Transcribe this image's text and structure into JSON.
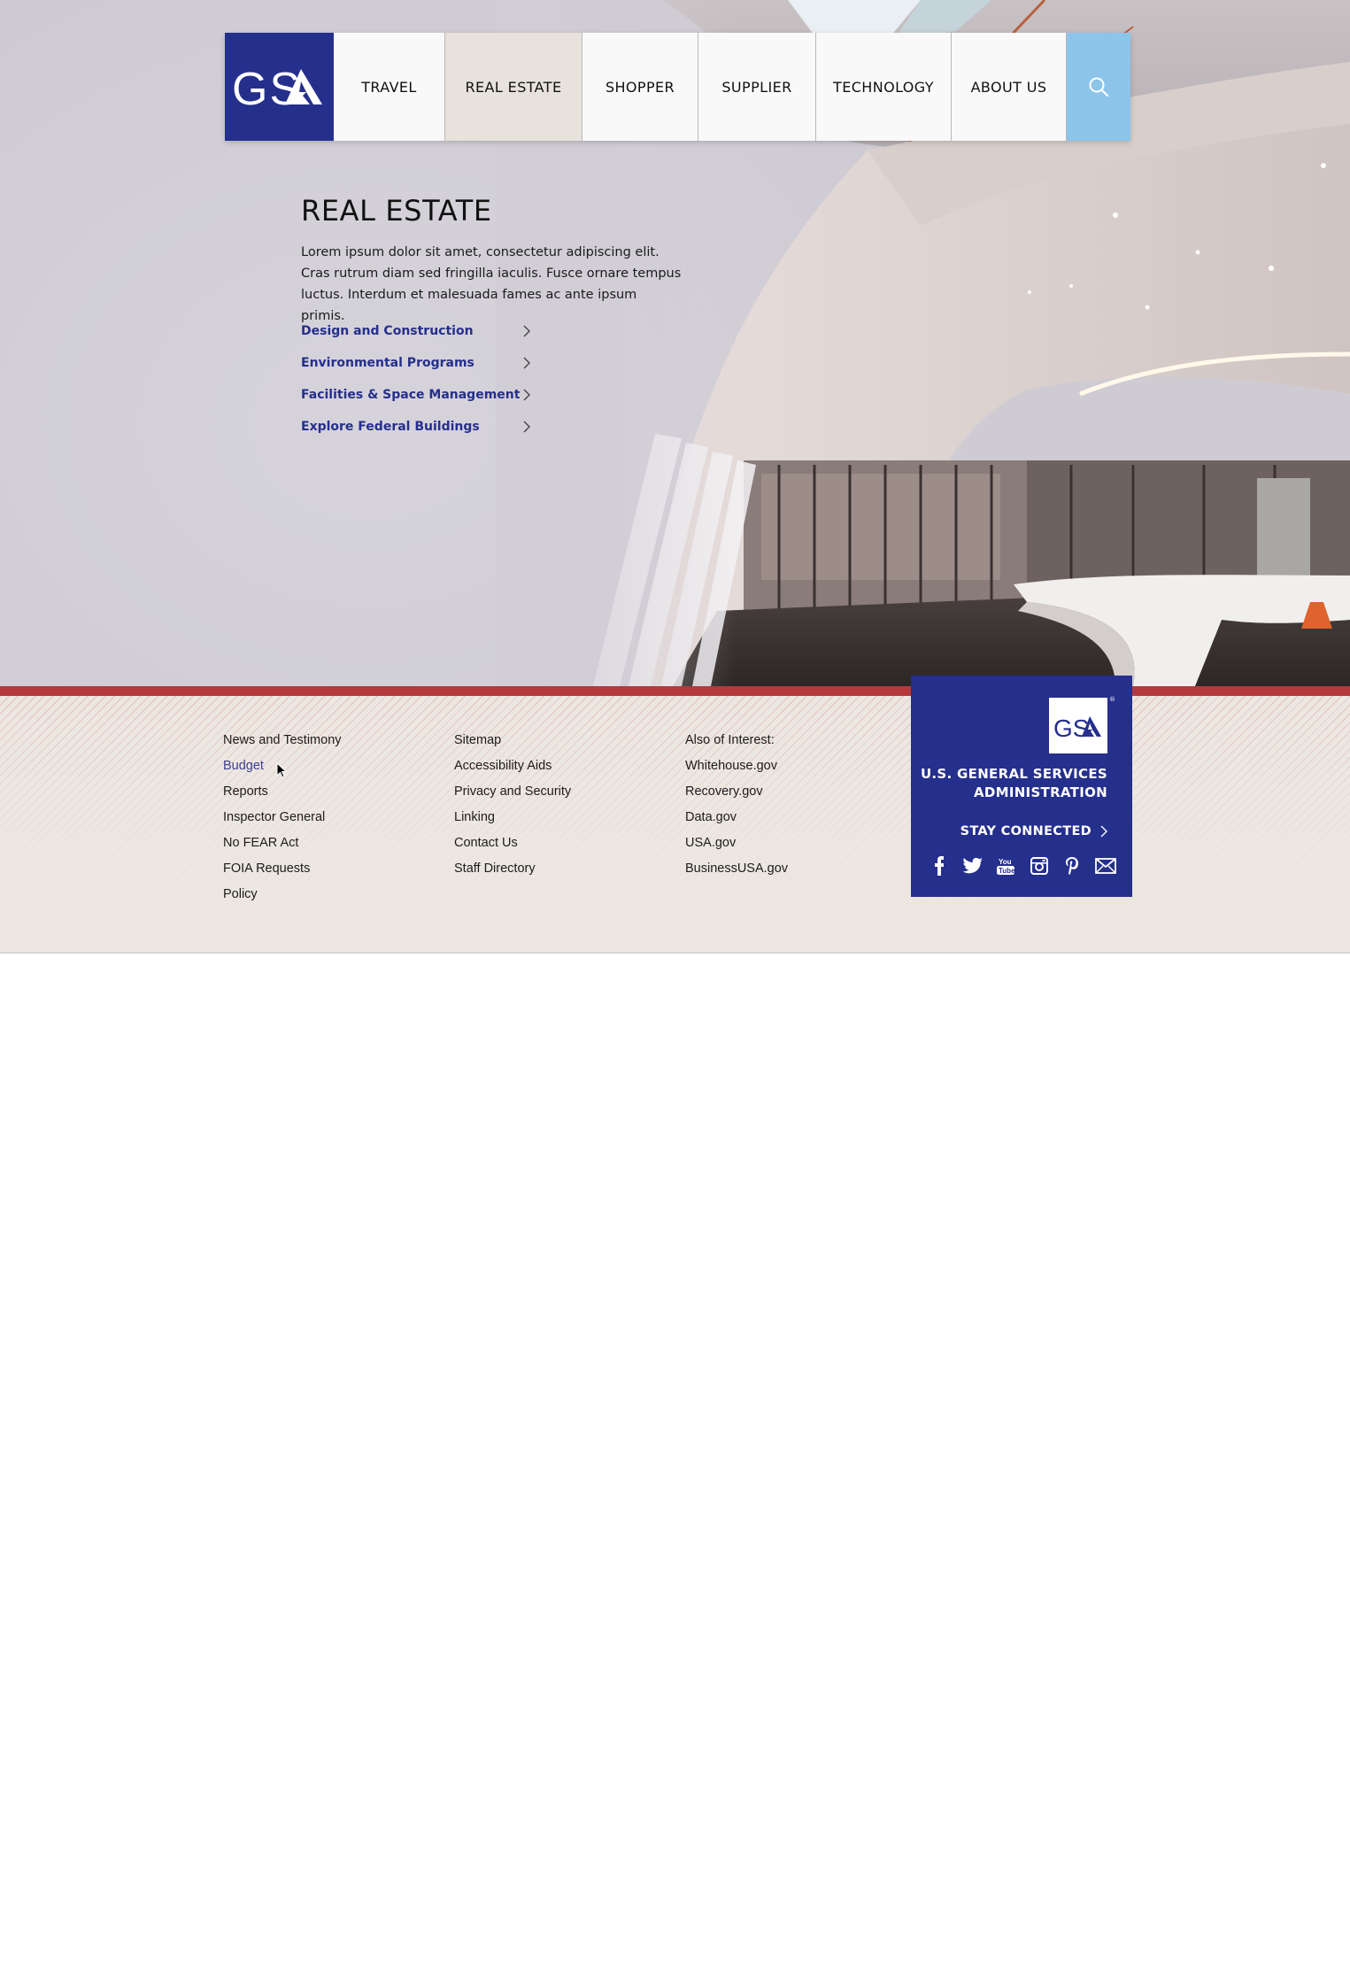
{
  "brand": {
    "logo_text": "GSA",
    "primary_color": "#252f8c",
    "accent_red": "#b5383d",
    "search_color": "#8dc4ea"
  },
  "nav": {
    "items": [
      {
        "label": "TRAVEL"
      },
      {
        "label": "REAL ESTATE",
        "active": true
      },
      {
        "label": "SHOPPER"
      },
      {
        "label": "SUPPLIER"
      },
      {
        "label": "TECHNOLOGY"
      },
      {
        "label": "ABOUT US"
      }
    ],
    "search_icon": "search-icon"
  },
  "hero": {
    "title": "REAL ESTATE",
    "description": "Lorem ipsum dolor sit amet, consectetur adipiscing elit. Cras rutrum diam sed fringilla iaculis. Fusce ornare tempus luctus. Interdum et malesuada fames ac ante ipsum primis.",
    "links": [
      {
        "label": "Design and Construction"
      },
      {
        "label": "Environmental Programs"
      },
      {
        "label": "Facilities & Space Management"
      },
      {
        "label": "Explore Federal Buildings"
      }
    ]
  },
  "footer": {
    "col1": [
      "News and Testimony",
      "Budget",
      "Reports",
      "Inspector General",
      "No FEAR Act",
      "FOIA Requests",
      "Policy"
    ],
    "col2": [
      "Sitemap",
      "Accessibility Aids",
      "Privacy and Security",
      "Linking",
      "Contact Us",
      "Staff Directory"
    ],
    "col3": [
      "Also of Interest:",
      "Whitehouse.gov",
      "Recovery.gov",
      "Data.gov",
      "USA.gov",
      "BusinessUSA.gov"
    ],
    "hovered_link": "Budget"
  },
  "gsa_box": {
    "logo_text": "GSA",
    "registered_mark": "®",
    "agency_line1": "U.S. GENERAL SERVICES",
    "agency_line2": "ADMINISTRATION",
    "stay_connected": "STAY CONNECTED",
    "socials": [
      "facebook-icon",
      "twitter-icon",
      "youtube-icon",
      "instagram-icon",
      "pinterest-icon",
      "email-icon"
    ]
  }
}
